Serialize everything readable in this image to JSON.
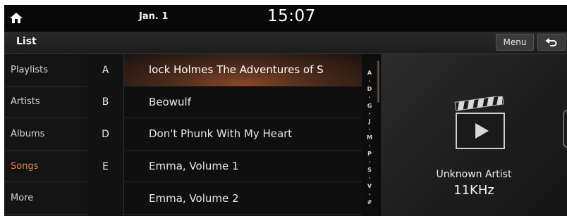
{
  "status_bar": {
    "date": "Jan. 1",
    "time": "15:07"
  },
  "header": {
    "title": "List",
    "menu_label": "Menu"
  },
  "categories": [
    {
      "label": "Playlists",
      "active": false
    },
    {
      "label": "Artists",
      "active": false
    },
    {
      "label": "Albums",
      "active": false
    },
    {
      "label": "Songs",
      "active": true
    },
    {
      "label": "More",
      "active": false
    }
  ],
  "index_letters": [
    "A",
    "B",
    "D",
    "E",
    ""
  ],
  "songs": [
    {
      "title": "lock Holmes   The Adventures of S",
      "highlighted": true
    },
    {
      "title": "Beowulf",
      "highlighted": false
    },
    {
      "title": "Don't Phunk With My Heart",
      "highlighted": false
    },
    {
      "title": "Emma, Volume 1",
      "highlighted": false
    },
    {
      "title": "Emma, Volume 2",
      "highlighted": false
    }
  ],
  "alpha_index": [
    "A",
    "·",
    "D",
    "·",
    "G",
    "·",
    "J",
    "·",
    "M",
    "·",
    "P",
    "·",
    "S",
    "·",
    "V",
    "·",
    "#"
  ],
  "now_playing": {
    "artist": "Unknown Artist",
    "sample_rate": "11KHz"
  },
  "colors": {
    "active_category": "#e4804a",
    "highlight": "#8a4a2a"
  }
}
